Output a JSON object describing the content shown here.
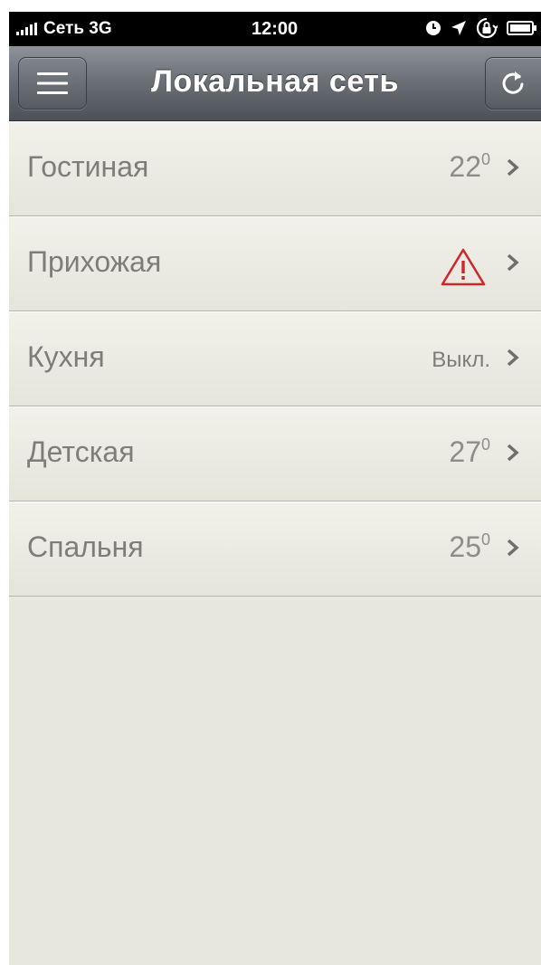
{
  "status_bar": {
    "carrier": "Сеть 3G",
    "time": "12:00",
    "icons": [
      "signal-icon",
      "clock-icon",
      "location-arrow-icon",
      "rotation-lock-icon",
      "battery-icon"
    ]
  },
  "nav": {
    "title": "Локальная сеть",
    "left_button_icon": "menu-icon",
    "right_button_icon": "refresh-icon"
  },
  "rooms": [
    {
      "name": "Гостиная",
      "value": "22",
      "unit": "0",
      "state": "temperature"
    },
    {
      "name": "Прихожая",
      "value": "",
      "unit": "",
      "state": "warning",
      "icon": "warning-icon"
    },
    {
      "name": "Кухня",
      "value": "Выкл.",
      "unit": "",
      "state": "off"
    },
    {
      "name": "Детская",
      "value": "27",
      "unit": "0",
      "state": "temperature"
    },
    {
      "name": "Спальня",
      "value": "25",
      "unit": "0",
      "state": "temperature"
    }
  ],
  "colors": {
    "nav_bar": "#6b7177",
    "background": "#e8e7df",
    "warning": "#d0262a",
    "text": "#7d7d7a"
  }
}
